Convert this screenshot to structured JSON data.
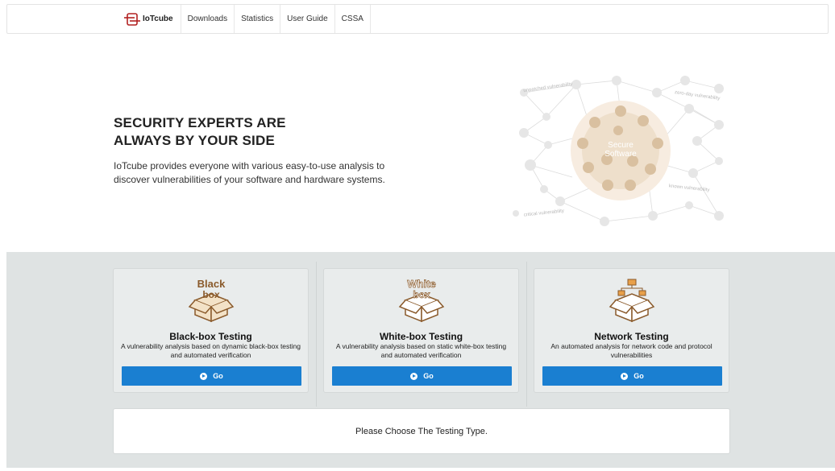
{
  "nav": {
    "brand": "IoTcube",
    "items": [
      "Downloads",
      "Statistics",
      "User Guide",
      "CSSA"
    ]
  },
  "hero": {
    "title_line1": "SECURITY EXPERTS ARE",
    "title_line2": "ALWAYS BY YOUR SIDE",
    "description": "IoTcube provides everyone with various easy-to-use analysis to discover vulnerabilities of your software and hardware systems.",
    "graphic": {
      "center_line1": "Secure",
      "center_line2": "Software",
      "labels": [
        "unpatched vulnerability",
        "zero-day vulnerability",
        "known vulnerability",
        "critical vulnerability"
      ]
    }
  },
  "cards": [
    {
      "icon": "black-box-icon",
      "icon_text": [
        "Black",
        "box"
      ],
      "title": "Black-box Testing",
      "desc": "A vulnerability analysis based on dynamic black-box testing and automated verification",
      "button": "Go"
    },
    {
      "icon": "white-box-icon",
      "icon_text": [
        "White",
        "box"
      ],
      "title": "White-box Testing",
      "desc": "A vulnerability analysis based on static white-box testing and automated verification",
      "button": "Go"
    },
    {
      "icon": "network-box-icon",
      "title": "Network Testing",
      "desc": "An automated analysis for network code and protocol vulnerabilities",
      "button": "Go"
    }
  ],
  "message": "Please Choose The Testing Type.",
  "colors": {
    "accent": "#1a7fd1",
    "section_bg": "#dfe3e3",
    "brand_red": "#b22222",
    "box_brown": "#a0723f"
  }
}
